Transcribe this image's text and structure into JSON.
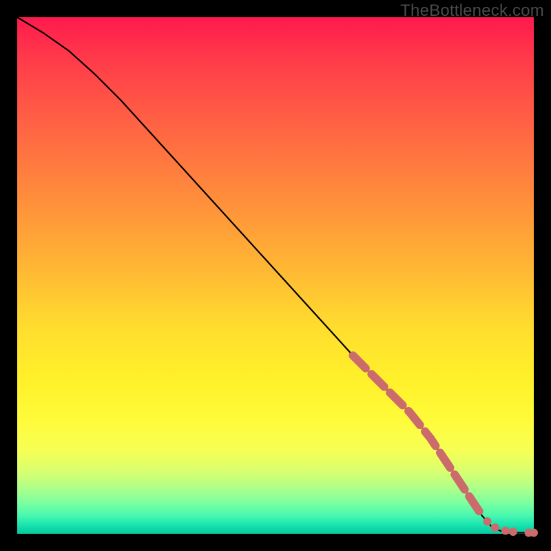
{
  "watermark": "TheBottleneck.com",
  "chart_data": {
    "type": "line",
    "title": "",
    "xlabel": "",
    "ylabel": "",
    "xlim": [
      0,
      100
    ],
    "ylim": [
      0,
      100
    ],
    "grid": false,
    "legend": false,
    "series": [
      {
        "name": "curve",
        "color": "#000000",
        "x": [
          0,
          5,
          10,
          15,
          20,
          25,
          30,
          35,
          40,
          45,
          50,
          55,
          60,
          65,
          66,
          68,
          70,
          72,
          74,
          76,
          78,
          80,
          82,
          84,
          86,
          88,
          90,
          92,
          94,
          96,
          98,
          100
        ],
        "y": [
          100,
          97,
          93.5,
          89,
          84,
          78.5,
          73,
          67.5,
          62,
          56.5,
          51,
          45.5,
          40,
          34.5,
          33.5,
          31.5,
          29.5,
          27.5,
          25.5,
          23.5,
          21,
          18.5,
          15.5,
          12.5,
          9.5,
          6.5,
          3.5,
          1.2,
          0.4,
          0.2,
          0.2,
          0.2
        ]
      }
    ],
    "markers": [
      {
        "name": "highlight-segment",
        "color": "#cc6b6b",
        "style": "thick-dash",
        "x": [
          65,
          66,
          68,
          70,
          72,
          74,
          76,
          78,
          80,
          82,
          84,
          86,
          88,
          90
        ],
        "y": [
          34.5,
          33.5,
          31.5,
          29.5,
          27.5,
          25.5,
          23.5,
          21,
          18.5,
          15.5,
          12.5,
          9.5,
          6.5,
          3.5
        ]
      },
      {
        "name": "tail-dots",
        "color": "#cc6b6b",
        "style": "dots",
        "x": [
          91,
          92.5,
          94.5,
          96,
          99,
          100
        ],
        "y": [
          2.4,
          1.2,
          0.6,
          0.4,
          0.2,
          0.2
        ]
      }
    ]
  }
}
